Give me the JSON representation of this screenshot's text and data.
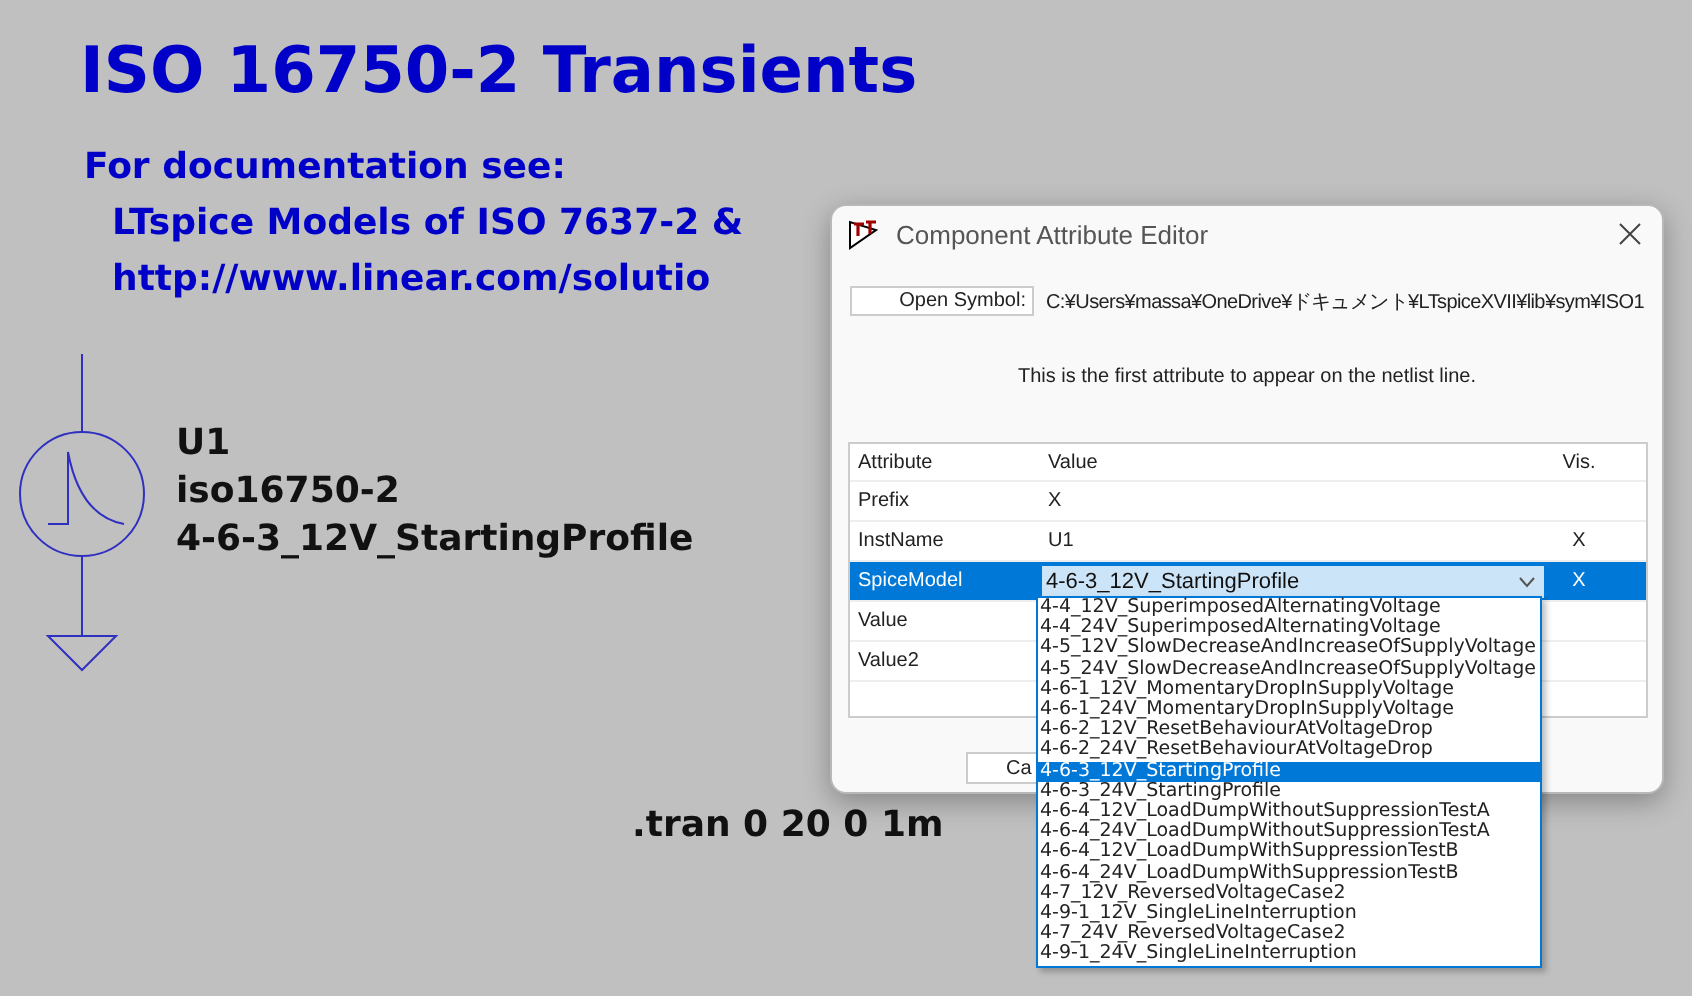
{
  "canvas": {
    "title": "ISO 16750-2 Transients",
    "doc_lines": [
      "For documentation see:",
      "LTspice Models of ISO 7637-2 &",
      "http://www.linear.com/solutio"
    ],
    "symbol_labels": [
      "U1",
      "iso16750-2",
      "4-6-3_12V_StartingProfile"
    ],
    "directive": ".tran 0 20 0 1m"
  },
  "dialog": {
    "title": "Component Attribute Editor",
    "open_symbol_button": "Open Symbol:",
    "symbol_path": "C:¥Users¥massa¥OneDrive¥ドキュメント¥LTspiceXVII¥lib¥sym¥ISO1",
    "description": "This is the first attribute to appear on the netlist line.",
    "table": {
      "columns": [
        "Attribute",
        "Value",
        "Vis."
      ],
      "rows": [
        {
          "kind": "text",
          "attribute": "Prefix",
          "value": "X",
          "selected": false
        },
        {
          "kind": "text",
          "attribute": "InstName",
          "value": "U1",
          "vis": "X",
          "selected": false
        },
        {
          "kind": "combo",
          "attribute": "SpiceModel",
          "value": "4-6-3_12V_StartingProfile",
          "vis": "X",
          "selected": true
        },
        {
          "kind": "text",
          "attribute": "Value",
          "selected": false
        },
        {
          "kind": "text",
          "attribute": "Value2",
          "selected": false
        }
      ]
    },
    "buttons": [
      "Ca"
    ],
    "dropdown_options": [
      {
        "label": "4-4_12V_SuperimposedAlternatingVoltage",
        "selected": false
      },
      {
        "label": "4-4_24V_SuperimposedAlternatingVoltage",
        "selected": false
      },
      {
        "label": "4-5_12V_SlowDecreaseAndIncreaseOfSupplyVoltage",
        "selected": false
      },
      {
        "label": "4-5_24V_SlowDecreaseAndIncreaseOfSupplyVoltage",
        "selected": false
      },
      {
        "label": "4-6-1_12V_MomentaryDropInSupplyVoltage",
        "selected": false
      },
      {
        "label": "4-6-1_24V_MomentaryDropInSupplyVoltage",
        "selected": false
      },
      {
        "label": "4-6-2_12V_ResetBehaviourAtVoltageDrop",
        "selected": false
      },
      {
        "label": "4-6-2_24V_ResetBehaviourAtVoltageDrop",
        "selected": false
      },
      {
        "label": "4-6-3_12V_StartingProfile",
        "selected": true
      },
      {
        "label": "4-6-3_24V_StartingProfile",
        "selected": false
      },
      {
        "label": "4-6-4_12V_LoadDumpWithoutSuppressionTestA",
        "selected": false
      },
      {
        "label": "4-6-4_24V_LoadDumpWithoutSuppressionTestA",
        "selected": false
      },
      {
        "label": "4-6-4_12V_LoadDumpWithSuppressionTestB",
        "selected": false
      },
      {
        "label": "4-6-4_24V_LoadDumpWithSuppressionTestB",
        "selected": false
      },
      {
        "label": "4-7_12V_ReversedVoltageCase2",
        "selected": false
      },
      {
        "label": "4-9-1_12V_SingleLineInterruption",
        "selected": false
      },
      {
        "label": "4-7_24V_ReversedVoltageCase2",
        "selected": false
      },
      {
        "label": "4-9-1_24V_SingleLineInterruption",
        "selected": false
      }
    ]
  }
}
